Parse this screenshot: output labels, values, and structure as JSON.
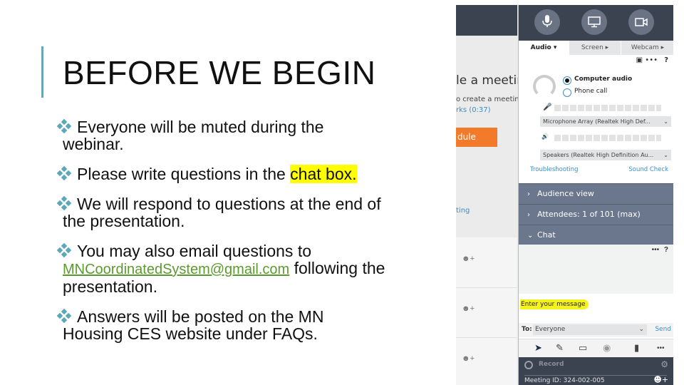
{
  "slide": {
    "title": "BEFORE WE BEGIN",
    "accent_color": "#6aa7b5",
    "bullet_color": "#5aa9b8",
    "bullets": [
      {
        "line1": "Everyone will be muted during the",
        "line2": "webinar."
      },
      {
        "pre": "Please write questions in the ",
        "highlight": "chat box."
      },
      {
        "line1": "We will respond to questions at the end of",
        "line2": "the presentation."
      },
      {
        "line1": "You may also email questions to",
        "email": "MNCoordinatedSystem@gmail.com",
        "after_email": " following the",
        "line3": "presentation."
      },
      {
        "line1": "Answers will be posted on the MN",
        "line2": "Housing CES website under FAQs."
      }
    ]
  },
  "screenshot": {
    "background_page": {
      "heading_fragment": "le a meetin",
      "subtext_fragment": "o create a meeting",
      "link_fragment": "rks (0:37)",
      "schedule_button_fragment": "dule",
      "ting_link_fragment": "ting",
      "list_row_icon": "add-user-icon"
    },
    "control_panel": {
      "top_buttons": [
        "microphone",
        "screen-share",
        "webcam"
      ],
      "tabs": [
        {
          "label": "Audio ▾",
          "active": true
        },
        {
          "label": "Screen ▸",
          "active": false
        },
        {
          "label": "Webcam ▸",
          "active": false
        }
      ],
      "toolbar_more": "•••",
      "toolbar_help": "?",
      "audio": {
        "options": [
          {
            "label": "Computer audio",
            "selected": true
          },
          {
            "label": "Phone call",
            "selected": false
          }
        ],
        "microphone_device": "Microphone Array (Realtek High Def...",
        "speaker_device": "Speakers (Realtek High Definition Au...",
        "troubleshooting": "Troubleshooting",
        "sound_check": "Sound Check"
      },
      "sections": [
        {
          "label": "Audience view",
          "expanded": false
        },
        {
          "label": "Attendees:  1 of 101 (max)",
          "expanded": false
        },
        {
          "label": "Chat",
          "expanded": true
        }
      ],
      "chat": {
        "more": "•••",
        "help": "?",
        "placeholder": "Enter your message",
        "to_label": "To:",
        "recipient": "Everyone",
        "send_label": "Send"
      },
      "record_label": "Record",
      "meeting_id": "Meeting ID: 324-002-005"
    }
  }
}
